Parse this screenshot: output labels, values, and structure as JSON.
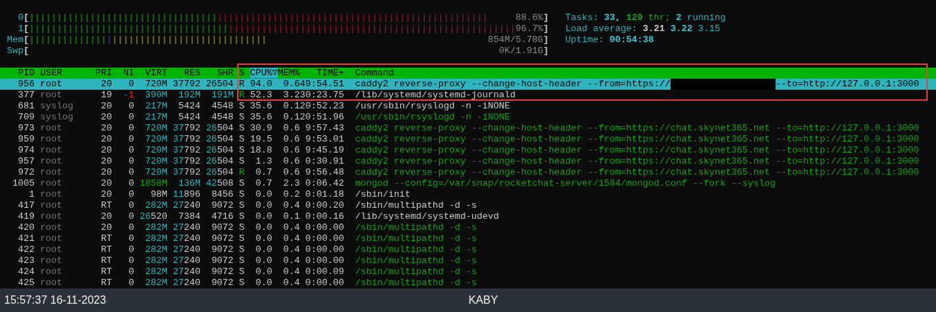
{
  "meter_brackets": [
    "[",
    "]"
  ],
  "meters": [
    {
      "label": "0",
      "segments": [
        {
          "kind": "user",
          "bars": "||||||||||||||||||||||||||||||||||"
        },
        {
          "kind": "kernel",
          "bars": "|||||||||||||||||||||||||||||||||||||||||||||||||"
        }
      ],
      "value": "88.6%"
    },
    {
      "label": "1",
      "segments": [
        {
          "kind": "user",
          "bars": "||||||||||||||||||||||||||||||||||||"
        },
        {
          "kind": "kernel",
          "bars": "||||||||||||||||||||||||||||||||||||||||||||||||||||"
        }
      ],
      "value": "96.7%"
    },
    {
      "label": "Mem",
      "segments": [
        {
          "kind": "used",
          "bars": "||||||||||||||"
        },
        {
          "kind": "buffers",
          "bars": "|"
        },
        {
          "kind": "cache",
          "bars": "||||||||||||||||||||||||||||"
        }
      ],
      "value": "854M/5.78G"
    },
    {
      "label": "Swp",
      "value": "0K/1.91G"
    }
  ],
  "tasks": {
    "label": "Tasks:",
    "count": "33,",
    "threads": "129",
    "threads_label": "thr;",
    "running": "2",
    "running_label": "running"
  },
  "load_average": {
    "label": "Load average:",
    "values": [
      "3.21",
      "3.22",
      "3.15"
    ]
  },
  "uptime": {
    "label": "Uptime:",
    "value": "00:54:38"
  },
  "process_table": {
    "sort_indicator": "▽",
    "annotation": {
      "kind": "outline"
    },
    "columns": [
      {
        "label": "PID",
        "sorted": false
      },
      {
        "label": "USER",
        "sorted": false
      },
      {
        "label": "PRI",
        "sorted": false
      },
      {
        "label": "NI",
        "sorted": false
      },
      {
        "label": "VIRT",
        "sorted": false
      },
      {
        "label": "RES",
        "sorted": false
      },
      {
        "label": "SHR",
        "sorted": false
      },
      {
        "label": "S",
        "sorted": false
      },
      {
        "label": "CPU%",
        "sorted": true
      },
      {
        "label": "MEM%",
        "sorted": false
      },
      {
        "label": "TIME+",
        "sorted": false
      },
      {
        "label": "Command",
        "sorted": false
      }
    ],
    "rows": [
      {
        "cells": [
          "956",
          "root",
          "20",
          "0",
          "720M",
          "37792",
          "26504",
          "R",
          "94.0",
          "0.6",
          "49:54.51",
          "caddy2 reverse-proxy --change-host-header --from=https://"
        ],
        "command_tail": "--to=http://127.0.0.1:3000",
        "selected": true,
        "redacted": true
      },
      {
        "cells": [
          "377",
          "root",
          "19",
          "-1",
          "390M",
          "192M",
          "191M",
          "R",
          "52.3",
          "3.2",
          "30:23.75",
          "/lib/systemd/systemd-journald"
        ],
        "selected": false,
        "redacted": false,
        "thread": false,
        "running": true
      },
      {
        "cells": [
          "681",
          "syslog",
          "20",
          "0",
          "217M",
          "5424",
          "4548",
          "S",
          "35.6",
          "0.1",
          "20:52.23",
          "/usr/sbin/rsyslogd -n -iNONE"
        ],
        "selected": false,
        "redacted": false,
        "thread": false,
        "running": false
      },
      {
        "cells": [
          "709",
          "syslog",
          "20",
          "0",
          "217M",
          "5424",
          "4548",
          "S",
          "35.6",
          "0.1",
          "20:51.96",
          "/usr/sbin/rsyslogd -n -iNONE"
        ],
        "selected": false,
        "redacted": false,
        "thread": true,
        "running": false
      },
      {
        "cells": [
          "973",
          "root",
          "20",
          "0",
          "720M",
          "37792",
          "26504",
          "S",
          "30.9",
          "0.6",
          "9:57.43",
          "caddy2 reverse-proxy --change-host-header --from=https://chat.skynet365.net --to=http://127.0.0.1:3000"
        ],
        "selected": false,
        "redacted": false,
        "thread": true,
        "running": false
      },
      {
        "cells": [
          "959",
          "root",
          "20",
          "0",
          "720M",
          "37792",
          "26504",
          "S",
          "19.5",
          "0.6",
          "9:53.01",
          "caddy2 reverse-proxy --change-host-header --from=https://chat.skynet365.net --to=http://127.0.0.1:3000"
        ],
        "selected": false,
        "redacted": false,
        "thread": true,
        "running": false
      },
      {
        "cells": [
          "974",
          "root",
          "20",
          "0",
          "720M",
          "37792",
          "26504",
          "S",
          "18.8",
          "0.6",
          "9:45.19",
          "caddy2 reverse-proxy --change-host-header --from=https://chat.skynet365.net --to=http://127.0.0.1:3000"
        ],
        "selected": false,
        "redacted": false,
        "thread": true,
        "running": false
      },
      {
        "cells": [
          "957",
          "root",
          "20",
          "0",
          "720M",
          "37792",
          "26504",
          "S",
          "1.3",
          "0.6",
          "0:30.91",
          "caddy2 reverse-proxy --change-host-header --from=https://chat.skynet365.net --to=http://127.0.0.1:3000"
        ],
        "selected": false,
        "redacted": false,
        "thread": true,
        "running": false
      },
      {
        "cells": [
          "972",
          "root",
          "20",
          "0",
          "720M",
          "37792",
          "26504",
          "R",
          "0.7",
          "0.6",
          "9:56.48",
          "caddy2 reverse-proxy --change-host-header --from=https://chat.skynet365.net --to=http://127.0.0.1:3000"
        ],
        "selected": false,
        "redacted": false,
        "thread": true,
        "running": true
      },
      {
        "cells": [
          "1005",
          "root",
          "20",
          "0",
          "1858M",
          "136M",
          "42508",
          "S",
          "0.7",
          "2.3",
          "0:06.42",
          "mongod --config=/var/snap/rocketchat-server/1584/mongod.conf --fork --syslog"
        ],
        "selected": false,
        "redacted": false,
        "thread": true,
        "running": false
      },
      {
        "cells": [
          "1",
          "root",
          "20",
          "0",
          "98M",
          "11896",
          "8456",
          "S",
          "0.0",
          "0.2",
          "0:01.18",
          "/sbin/init"
        ],
        "selected": false,
        "redacted": false,
        "thread": false,
        "running": false
      },
      {
        "cells": [
          "417",
          "root",
          "RT",
          "0",
          "282M",
          "27240",
          "9072",
          "S",
          "0.0",
          "0.4",
          "0:00.20",
          "/sbin/multipathd -d -s"
        ],
        "selected": false,
        "redacted": false,
        "thread": false,
        "running": false
      },
      {
        "cells": [
          "419",
          "root",
          "20",
          "0",
          "26520",
          "7384",
          "4716",
          "S",
          "0.0",
          "0.1",
          "0:00.16",
          "/lib/systemd/systemd-udevd"
        ],
        "selected": false,
        "redacted": false,
        "thread": false,
        "running": false
      },
      {
        "cells": [
          "420",
          "root",
          "20",
          "0",
          "282M",
          "27240",
          "9072",
          "S",
          "0.0",
          "0.4",
          "0:00.00",
          "/sbin/multipathd -d -s"
        ],
        "selected": false,
        "redacted": false,
        "thread": true,
        "running": false
      },
      {
        "cells": [
          "421",
          "root",
          "RT",
          "0",
          "282M",
          "27240",
          "9072",
          "S",
          "0.0",
          "0.4",
          "0:00.00",
          "/sbin/multipathd -d -s"
        ],
        "selected": false,
        "redacted": false,
        "thread": true,
        "running": false
      },
      {
        "cells": [
          "422",
          "root",
          "RT",
          "0",
          "282M",
          "27240",
          "9072",
          "S",
          "0.0",
          "0.4",
          "0:00.00",
          "/sbin/multipathd -d -s"
        ],
        "selected": false,
        "redacted": false,
        "thread": true,
        "running": false
      },
      {
        "cells": [
          "423",
          "root",
          "RT",
          "0",
          "282M",
          "27240",
          "9072",
          "S",
          "0.0",
          "0.4",
          "0:00.00",
          "/sbin/multipathd -d -s"
        ],
        "selected": false,
        "redacted": false,
        "thread": true,
        "running": false
      },
      {
        "cells": [
          "424",
          "root",
          "RT",
          "0",
          "282M",
          "27240",
          "9072",
          "S",
          "0.0",
          "0.4",
          "0:00.09",
          "/sbin/multipathd -d -s"
        ],
        "selected": false,
        "redacted": false,
        "thread": true,
        "running": false
      },
      {
        "cells": [
          "425",
          "root",
          "RT",
          "0",
          "282M",
          "27240",
          "9072",
          "S",
          "0.0",
          "0.4",
          "0:00.00",
          "/sbin/multipathd -d -s"
        ],
        "selected": false,
        "redacted": false,
        "thread": true,
        "running": false
      }
    ]
  },
  "status_bar": {
    "datetime": "15:57:37 16-11-2023",
    "host": "KABY"
  }
}
